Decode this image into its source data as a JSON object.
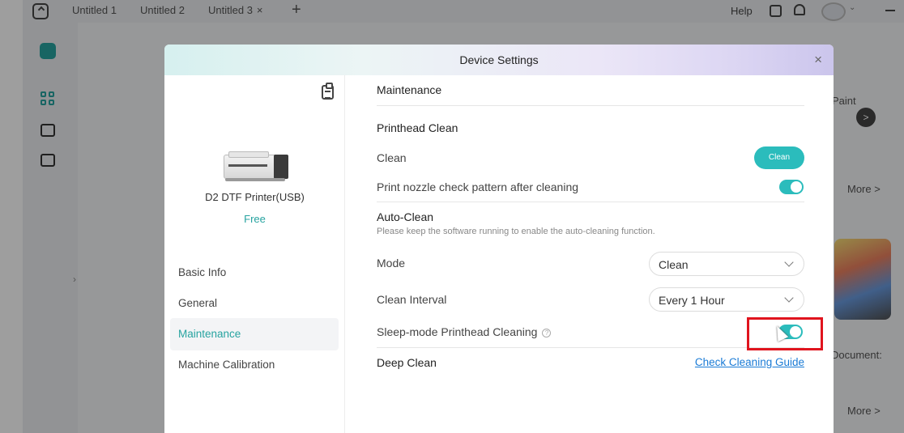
{
  "titlebar": {
    "tabs": [
      {
        "label": "Untitled 1"
      },
      {
        "label": "Untitled 2"
      },
      {
        "label": "Untitled 3",
        "close": "×"
      }
    ],
    "new_tab": "+",
    "help": "Help"
  },
  "background": {
    "paint_label": "Paint",
    "more_label_1": "More >",
    "document_label": "Document:",
    "more_label_2": "More >",
    "arrow": ">"
  },
  "modal": {
    "title": "Device Settings",
    "close": "×",
    "device": {
      "name": "D2 DTF Printer(USB)",
      "status": "Free"
    },
    "menu": [
      {
        "label": "Basic Info",
        "active": false
      },
      {
        "label": "General",
        "active": false
      },
      {
        "label": "Maintenance",
        "active": true
      },
      {
        "label": "Machine Calibration",
        "active": false
      }
    ],
    "maintenance": {
      "section_title": "Maintenance",
      "printhead_clean": {
        "heading": "Printhead Clean",
        "clean_label": "Clean",
        "clean_button": "Clean",
        "nozzle_check_label": "Print nozzle check pattern after cleaning",
        "nozzle_check_on": true
      },
      "auto_clean": {
        "heading": "Auto-Clean",
        "description": "Please keep the software running to enable the auto-cleaning function.",
        "mode_label": "Mode",
        "mode_value": "Clean",
        "interval_label": "Clean Interval",
        "interval_value": "Every 1 Hour",
        "sleep_label": "Sleep-mode Printhead Cleaning",
        "sleep_on": true
      },
      "deep_clean": {
        "heading": "Deep Clean",
        "guide_link": "Check Cleaning Guide"
      }
    }
  },
  "colors": {
    "accent": "#2bbcbc",
    "active_text": "#27a3a0",
    "link": "#1a7bd6",
    "highlight": "#e0141e"
  }
}
